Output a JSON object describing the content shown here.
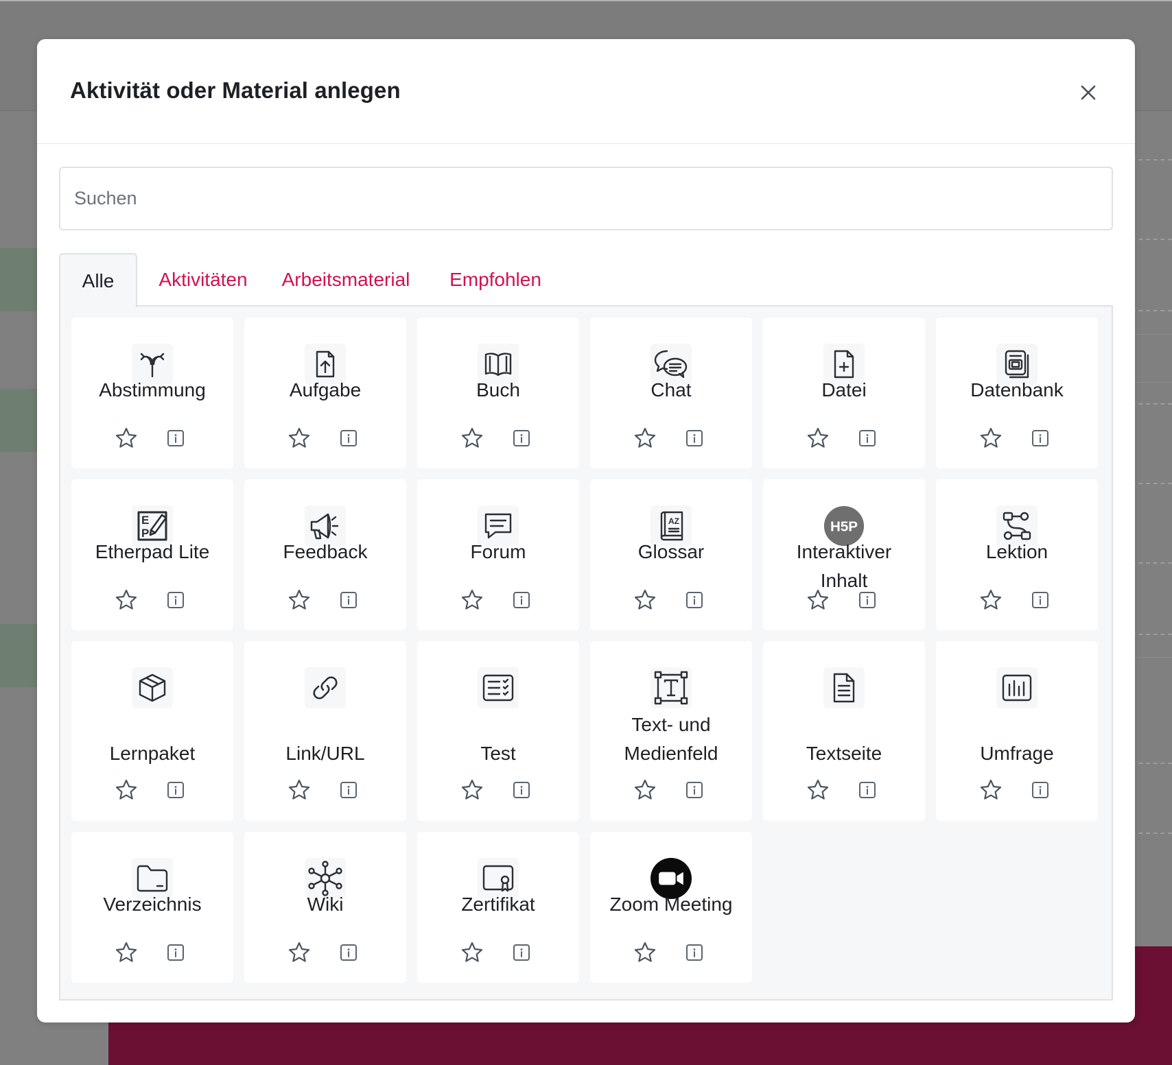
{
  "modal": {
    "title": "Aktivität oder Material anlegen",
    "close_icon": "close-icon"
  },
  "search": {
    "placeholder": "Suchen",
    "value": ""
  },
  "tabs": [
    {
      "label": "Alle",
      "active": true
    },
    {
      "label": "Aktivitäten",
      "active": false
    },
    {
      "label": "Arbeitsmaterial",
      "active": false
    },
    {
      "label": "Empfohlen",
      "active": false
    }
  ],
  "colors": {
    "accent": "#d2114f",
    "text": "#1d2125",
    "icon_stroke": "#59656f"
  },
  "items": [
    {
      "label": "Abstimmung",
      "icon": "choice-icon"
    },
    {
      "label": "Aufgabe",
      "icon": "assignment-upload-icon"
    },
    {
      "label": "Buch",
      "icon": "book-icon"
    },
    {
      "label": "Chat",
      "icon": "chat-icon"
    },
    {
      "label": "Datei",
      "icon": "file-icon"
    },
    {
      "label": "Datenbank",
      "icon": "database-icon"
    },
    {
      "label": "Etherpad Lite",
      "icon": "etherpad-icon"
    },
    {
      "label": "Feedback",
      "icon": "megaphone-icon"
    },
    {
      "label": "Forum",
      "icon": "forum-icon"
    },
    {
      "label": "Glossar",
      "icon": "glossary-icon"
    },
    {
      "label": "Interaktiver Inhalt",
      "icon": "h5p-icon",
      "icon_text": "H5P"
    },
    {
      "label": "Lektion",
      "icon": "lesson-icon"
    },
    {
      "label": "Lernpaket",
      "icon": "package-icon"
    },
    {
      "label": "Link/URL",
      "icon": "link-icon"
    },
    {
      "label": "Test",
      "icon": "quiz-icon"
    },
    {
      "label": "Text- und Medienfeld",
      "icon": "text-media-icon"
    },
    {
      "label": "Textseite",
      "icon": "page-icon"
    },
    {
      "label": "Umfrage",
      "icon": "survey-icon"
    },
    {
      "label": "Verzeichnis",
      "icon": "folder-icon"
    },
    {
      "label": "Wiki",
      "icon": "wiki-icon"
    },
    {
      "label": "Zertifikat",
      "icon": "certificate-icon"
    },
    {
      "label": "Zoom Meeting",
      "icon": "zoom-icon"
    }
  ]
}
